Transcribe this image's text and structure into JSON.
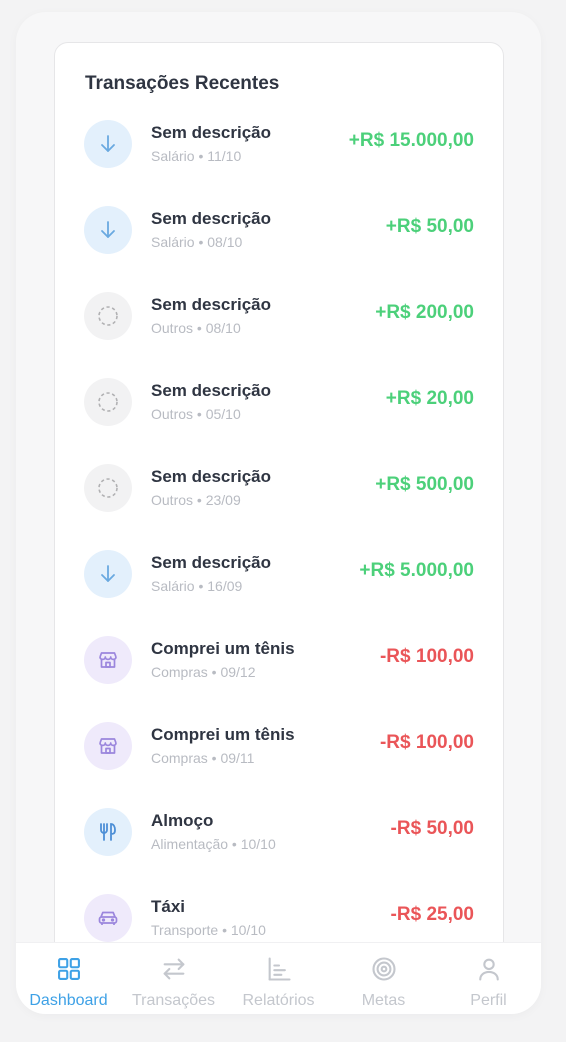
{
  "section_title": "Transações Recentes",
  "transactions": [
    {
      "title": "Sem descrição",
      "subtitle": "Salário • 11/10",
      "amount": "+R$ 15.000,00",
      "type": "income",
      "icon": "arrow-down-icon",
      "category": "salario"
    },
    {
      "title": "Sem descrição",
      "subtitle": "Salário • 08/10",
      "amount": "+R$ 50,00",
      "type": "income",
      "icon": "arrow-down-icon",
      "category": "salario"
    },
    {
      "title": "Sem descrição",
      "subtitle": "Outros • 08/10",
      "amount": "+R$ 200,00",
      "type": "income",
      "icon": "dashed-circle-icon",
      "category": "outros"
    },
    {
      "title": "Sem descrição",
      "subtitle": "Outros • 05/10",
      "amount": "+R$ 20,00",
      "type": "income",
      "icon": "dashed-circle-icon",
      "category": "outros"
    },
    {
      "title": "Sem descrição",
      "subtitle": "Outros • 23/09",
      "amount": "+R$ 500,00",
      "type": "income",
      "icon": "dashed-circle-icon",
      "category": "outros"
    },
    {
      "title": "Sem descrição",
      "subtitle": "Salário • 16/09",
      "amount": "+R$ 5.000,00",
      "type": "income",
      "icon": "arrow-down-icon",
      "category": "salario"
    },
    {
      "title": "Comprei um tênis",
      "subtitle": "Compras • 09/12",
      "amount": "-R$ 100,00",
      "type": "expense",
      "icon": "store-icon",
      "category": "compras"
    },
    {
      "title": "Comprei um tênis",
      "subtitle": "Compras • 09/11",
      "amount": "-R$ 100,00",
      "type": "expense",
      "icon": "store-icon",
      "category": "compras"
    },
    {
      "title": "Almoço",
      "subtitle": "Alimentação • 10/10",
      "amount": "-R$ 50,00",
      "type": "expense",
      "icon": "utensils-icon",
      "category": "alimentacao"
    },
    {
      "title": "Táxi",
      "subtitle": "Transporte • 10/10",
      "amount": "-R$ 25,00",
      "type": "expense",
      "icon": "car-icon",
      "category": "transporte"
    }
  ],
  "nav": {
    "items": [
      {
        "label": "Dashboard",
        "icon": "dashboard-grid-icon",
        "active": true
      },
      {
        "label": "Transações",
        "icon": "transfer-arrows-icon",
        "active": false
      },
      {
        "label": "Relatórios",
        "icon": "bar-chart-icon",
        "active": false
      },
      {
        "label": "Metas",
        "icon": "target-icon",
        "active": false
      },
      {
        "label": "Perfil",
        "icon": "user-icon",
        "active": false
      }
    ]
  },
  "colors": {
    "income": "#4cd07a",
    "expense": "#ea5558",
    "accent": "#3ea1e6",
    "inactive": "#c4c7cd"
  }
}
